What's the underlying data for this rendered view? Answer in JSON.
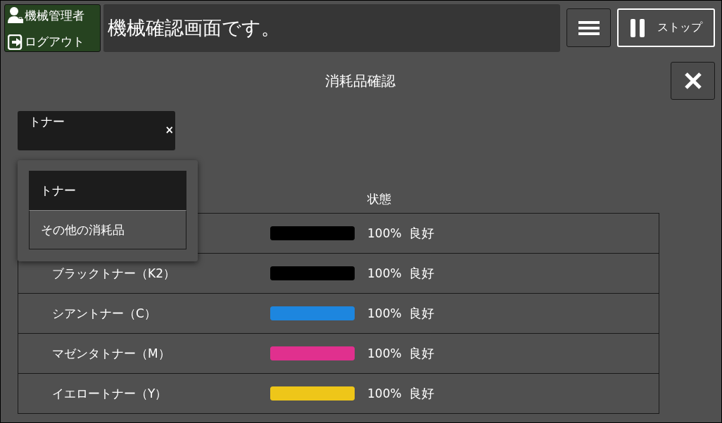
{
  "header": {
    "user": {
      "role": "機械管理者",
      "logout": "ログアウト"
    },
    "message": "機械確認画面です。",
    "stop_button": "ストップ"
  },
  "title": "消耗品確認",
  "category_field": {
    "value": "トナー",
    "clear": "×",
    "expanded": true,
    "options": [
      {
        "label": "トナー",
        "selected": true
      },
      {
        "label": "その他の消耗品",
        "selected": false
      }
    ]
  },
  "table": {
    "columns": [
      "状態"
    ],
    "rows": [
      {
        "color": "#000000",
        "reading": "100%",
        "status": "良好"
      },
      {
        "name": "ブラックトナー（K2）",
        "color": "#000000",
        "reading": "100%",
        "status": "良好"
      },
      {
        "name": "シアントナー（C）",
        "color": "#1d86df",
        "reading": "100%",
        "status": "良好"
      },
      {
        "name": "マゼンタトナー（M）",
        "color": "#e0308e",
        "reading": "100%",
        "status": "良好"
      },
      {
        "name": "イエロートナー（Y）",
        "color": "#eec619",
        "reading": "100%",
        "status": "良好"
      }
    ]
  }
}
